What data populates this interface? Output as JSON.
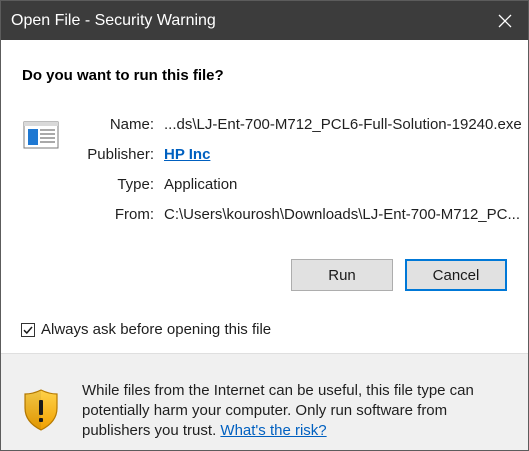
{
  "window": {
    "title": "Open File - Security Warning"
  },
  "question": "Do you want to run this file?",
  "details": {
    "name_label": "Name:",
    "name_value": "...ds\\LJ-Ent-700-M712_PCL6-Full-Solution-19240.exe",
    "publisher_label": "Publisher:",
    "publisher_value": "HP Inc",
    "type_label": "Type:",
    "type_value": "Application",
    "from_label": "From:",
    "from_value": "C:\\Users\\kourosh\\Downloads\\LJ-Ent-700-M712_PC..."
  },
  "buttons": {
    "run": "Run",
    "cancel": "Cancel"
  },
  "checkbox": {
    "label": "Always ask before opening this file",
    "checked": true
  },
  "warning": {
    "text": "While files from the Internet can be useful, this file type can potentially harm your computer. Only run software from publishers you trust.",
    "link": "What's the risk?"
  },
  "icons": {
    "close": "close-icon",
    "file": "executable-file-icon",
    "shield": "warning-shield-icon",
    "check": "checkmark-icon"
  },
  "colors": {
    "titlebar": "#3c3c3c",
    "link": "#0060c0",
    "accent": "#0078d7",
    "footer": "#f0f0f0"
  }
}
